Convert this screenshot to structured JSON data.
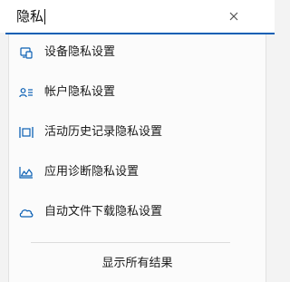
{
  "search": {
    "query": "隐私",
    "clear_icon": "close-icon"
  },
  "colors": {
    "accent": "#0a5fb4",
    "icon": "#0a5fb4"
  },
  "results": [
    {
      "label": "设备隐私设置",
      "icon": "device-icon"
    },
    {
      "label": "帐户隐私设置",
      "icon": "account-icon"
    },
    {
      "label": "活动历史记录隐私设置",
      "icon": "activity-history-icon"
    },
    {
      "label": "应用诊断隐私设置",
      "icon": "app-diagnostics-icon"
    },
    {
      "label": "自动文件下载隐私设置",
      "icon": "cloud-icon"
    }
  ],
  "footer": {
    "show_all_label": "显示所有结果"
  }
}
